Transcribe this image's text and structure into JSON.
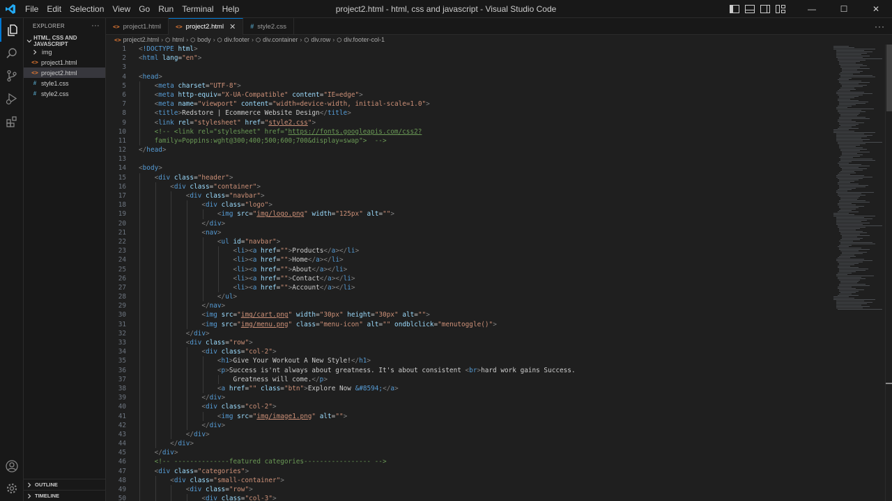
{
  "window": {
    "title": "project2.html - html, css and javascript - Visual Studio Code",
    "menu": [
      "File",
      "Edit",
      "Selection",
      "View",
      "Go",
      "Run",
      "Terminal",
      "Help"
    ],
    "minimize": "—",
    "maximize": "☐",
    "close": "✕"
  },
  "sidebar": {
    "title": "EXPLORER",
    "more": "···",
    "folder": "HTML, CSS AND JAVASCRIPT",
    "tree": [
      "img",
      "project1.html",
      "project2.html",
      "style1.css",
      "style2.css"
    ],
    "outline": "OUTLINE",
    "timeline": "TIMELINE"
  },
  "tabs": [
    {
      "label": "project1.html",
      "kind": "html"
    },
    {
      "label": "project2.html",
      "kind": "html"
    },
    {
      "label": "style2.css",
      "kind": "css"
    }
  ],
  "tabs_more": "···",
  "breadcrumb": [
    "project2.html",
    "html",
    "body",
    "div.footer",
    "div.container",
    "div.row",
    "div.footer-col-1"
  ],
  "code": {
    "line_numbers": [
      "1",
      "2",
      "3",
      "4",
      "5",
      "6",
      "7",
      "8",
      "9",
      "10",
      "11",
      "12",
      "13",
      "14",
      "15",
      "16",
      "17",
      "18",
      "19",
      "20",
      "21",
      "22",
      "23",
      "24",
      "25",
      "26",
      "27",
      "28",
      "29",
      "30",
      "31",
      "32",
      "33",
      "34",
      "35",
      "36",
      "37",
      "38",
      "39",
      "40",
      "41",
      "42",
      "43",
      "44",
      "45",
      "46",
      "47",
      "48",
      "49",
      "50"
    ],
    "content": {
      "doctype": "!DOCTYPE",
      "text_l8": "Redstore | Ecommerce Website Design",
      "comment_l10_pre": "<!-- <link rel=\"stylesheet\" href=\"",
      "comment_l10_url": "https://fonts.googleapis.com/css2?",
      "comment_l11": "family=Poppins:wght@300;400;500;600;700&display=swap\">  -->",
      "nav_products": "Products",
      "nav_home": "Home",
      "nav_about": "About",
      "nav_contact": "Contact",
      "nav_account": "Account",
      "h1_text": "Give Your Workout A New Style!",
      "p_text_l36_a": "Success is'nt always about greatness. It's about consistent ",
      "p_text_l36_b": "hard work gains Success.",
      "p_text_l37": "Greatness will come.",
      "btn_text": "Explore Now ",
      "btn_entity": "&#8594;",
      "comment_l46": "<!-- --------------featured categories----------------- -->"
    }
  },
  "colors": {
    "accent": "#0078d4",
    "tag_bracket": "#808080",
    "tag_name": "#569cd6",
    "attr_name": "#9cdcfe",
    "attr_value": "#ce9178",
    "comment": "#6a9955",
    "html_icon": "#e37933",
    "css_icon": "#519aba",
    "vscode_logo": "#23a9f2"
  },
  "icons": [
    "vscode-logo-icon",
    "files-icon",
    "search-icon",
    "source-control-icon",
    "run-debug-icon",
    "extensions-icon",
    "account-icon",
    "settings-gear-icon"
  ]
}
